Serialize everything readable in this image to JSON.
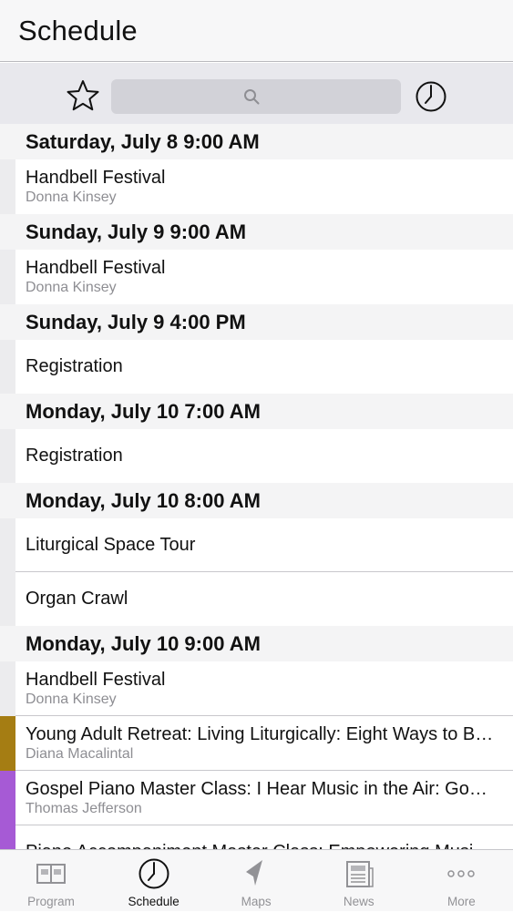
{
  "nav": {
    "title": "Schedule"
  },
  "toolbar": {
    "search_placeholder": ""
  },
  "colors": {
    "default_bar": "#ececee",
    "olive": "#a57d13",
    "purple": "#a65ad5"
  },
  "sections": [
    {
      "header": "Saturday, July 8 9:00 AM",
      "items": [
        {
          "title": "Handbell Festival",
          "subtitle": "Donna Kinsey",
          "color": "#ececee"
        }
      ]
    },
    {
      "header": "Sunday, July 9 9:00 AM",
      "items": [
        {
          "title": "Handbell Festival",
          "subtitle": "Donna Kinsey",
          "color": "#ececee"
        }
      ]
    },
    {
      "header": "Sunday, July 9 4:00 PM",
      "items": [
        {
          "title": "Registration",
          "subtitle": "",
          "color": "#ececee"
        }
      ]
    },
    {
      "header": "Monday, July 10 7:00 AM",
      "items": [
        {
          "title": "Registration",
          "subtitle": "",
          "color": "#ececee"
        }
      ]
    },
    {
      "header": "Monday, July 10 8:00 AM",
      "items": [
        {
          "title": "Liturgical Space Tour",
          "subtitle": "",
          "color": "#ececee"
        },
        {
          "title": "Organ Crawl",
          "subtitle": "",
          "color": "#ececee"
        }
      ]
    },
    {
      "header": "Monday, July 10 9:00 AM",
      "items": [
        {
          "title": "Handbell Festival",
          "subtitle": "Donna Kinsey",
          "color": "#ececee"
        },
        {
          "title": "Young Adult Retreat: Living Liturgically: Eight Ways to B…",
          "subtitle": "Diana Macalintal",
          "color": "#a57d13"
        },
        {
          "title": "Gospel Piano Master Class: I Hear Music in the Air: Go…",
          "subtitle": "Thomas Jefferson",
          "color": "#a65ad5"
        },
        {
          "title": "Piano Accompaniment Master Class: Empowering Musi…",
          "subtitle": "",
          "color": "#a65ad5"
        }
      ]
    }
  ],
  "tabs": [
    {
      "label": "Program",
      "icon": "program-icon",
      "active": false
    },
    {
      "label": "Schedule",
      "icon": "clock-icon",
      "active": true
    },
    {
      "label": "Maps",
      "icon": "location-arrow-icon",
      "active": false
    },
    {
      "label": "News",
      "icon": "newspaper-icon",
      "active": false
    },
    {
      "label": "More",
      "icon": "more-dots-icon",
      "active": false
    }
  ]
}
